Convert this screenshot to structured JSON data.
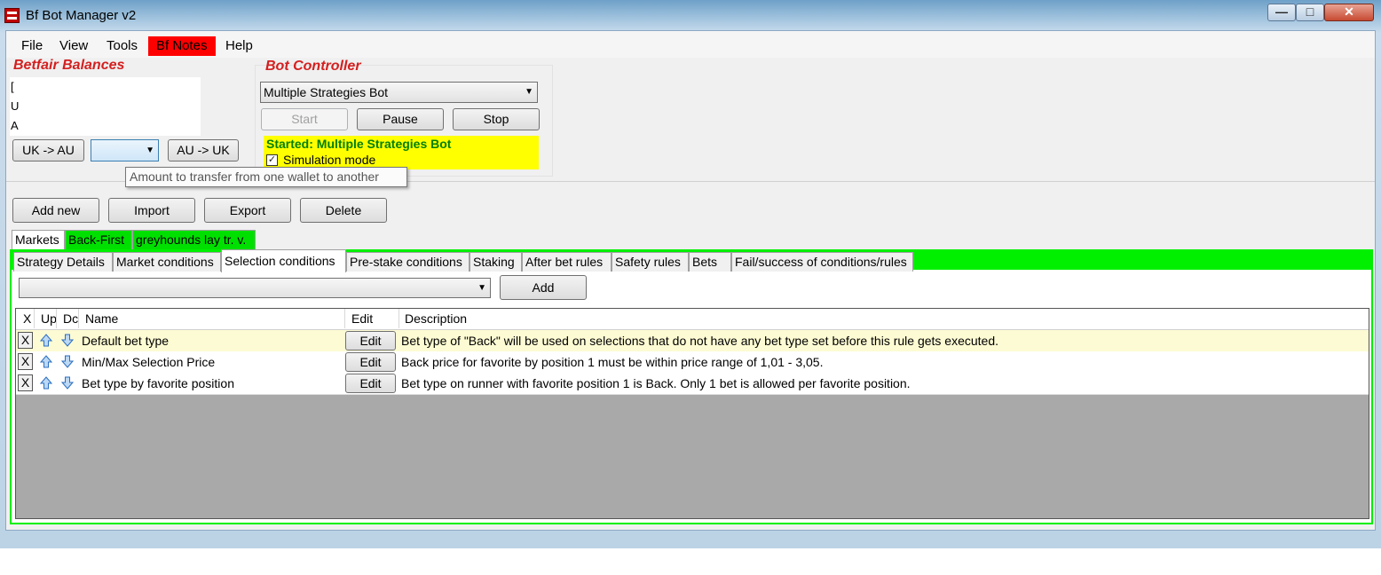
{
  "window": {
    "title": "Bf Bot Manager v2",
    "controls": [
      "—",
      "□",
      "✕"
    ]
  },
  "menu": [
    {
      "label": "File"
    },
    {
      "label": "View"
    },
    {
      "label": "Tools"
    },
    {
      "label": "Bf Notes",
      "highlight": "#ff0000"
    },
    {
      "label": "Help"
    }
  ],
  "balances": {
    "title": "Betfair Balances",
    "line1": "[",
    "line2": "U",
    "line3": "A",
    "uk_to_au": "UK -> AU",
    "amount_value": "",
    "au_to_uk": "AU -> UK",
    "tooltip": "Amount to transfer from one wallet to another"
  },
  "bot": {
    "title": "Bot Controller",
    "selected_bot": "Multiple Strategies Bot",
    "start": "Start",
    "pause": "Pause",
    "stop": "Stop",
    "status": "Started: Multiple Strategies Bot",
    "simulation_label": "Simulation mode",
    "simulation_checked": true,
    "status_bg": "#ffff00",
    "status_color": "#008000"
  },
  "actions": {
    "add_new": "Add new",
    "import": "Import",
    "export": "Export",
    "delete": "Delete"
  },
  "strategy_tabs": [
    {
      "label": "Markets",
      "active": true
    },
    {
      "label": "Back-First",
      "bg": "#00e000"
    },
    {
      "label": "greyhounds lay tr. v.",
      "bg": "#00e000"
    }
  ],
  "detail_tabs": [
    {
      "label": "Strategy Details"
    },
    {
      "label": "Market conditions"
    },
    {
      "label": "Selection conditions",
      "active": true
    },
    {
      "label": "Pre-stake conditions"
    },
    {
      "label": "Staking"
    },
    {
      "label": "After bet rules"
    },
    {
      "label": "Safety rules"
    },
    {
      "label": "Bets"
    },
    {
      "label": "Fail/success of conditions/rules"
    }
  ],
  "condition_picker": {
    "value": "",
    "add_label": "Add"
  },
  "table": {
    "headers": {
      "x": "X",
      "up": "Up",
      "down": "Dc",
      "name": "Name",
      "edit": "Edit",
      "description": "Description"
    },
    "rows": [
      {
        "x": "X",
        "name": "Default bet type",
        "edit": "Edit",
        "description": "Bet type of \"Back\" will be used on selections that do not have any bet type set before this rule gets executed.",
        "selected": true
      },
      {
        "x": "X",
        "name": "Min/Max Selection Price",
        "edit": "Edit",
        "description": "Back price  for favorite by position 1 must be within price range of 1,01 - 3,05."
      },
      {
        "x": "X",
        "name": "Bet type by favorite position",
        "edit": "Edit",
        "description": "Bet type on runner with favorite position 1 is Back. Only 1 bet is allowed per favorite position."
      }
    ]
  },
  "colors": {
    "tab_strip_green": "#00f000",
    "selected_row": "#fdfbd3",
    "table_background": "#a9a9a9"
  }
}
